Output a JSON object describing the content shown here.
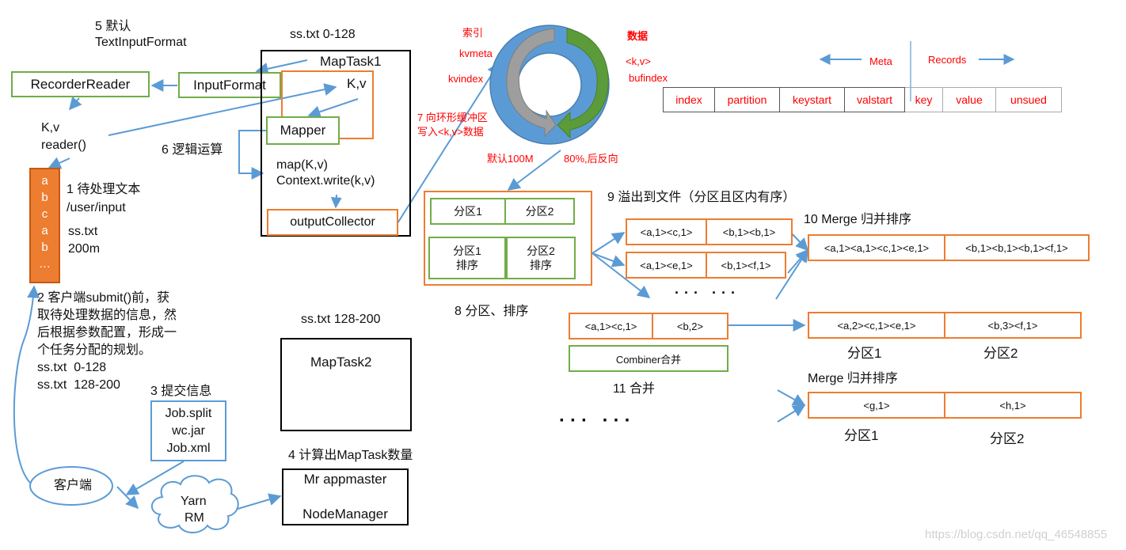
{
  "colors": {
    "green": "#70ad47",
    "orange": "#ed7d31",
    "blue": "#5b9bd5",
    "red": "#ff0000",
    "ring": "#5b9bd5",
    "gray_arrow": "#9e9e9e",
    "green_arrow": "#5c9b3a"
  },
  "step5": {
    "line1": "5 默认",
    "line2": "TextInputFormat"
  },
  "recorder_reader": "RecorderReader",
  "input_format": "InputFormat",
  "kv_reader": {
    "line1": "K,v",
    "line2": "reader()"
  },
  "step6": "6 逻辑运算",
  "maptask1": {
    "split_label": "ss.txt 0-128",
    "title": "MapTask1",
    "kv": "K,v",
    "mapper": "Mapper",
    "map_call": "map(K,v)",
    "context_write": "Context.write(k,v)",
    "output_collector": "outputCollector"
  },
  "input_file": {
    "letters": [
      "a",
      "b",
      "c",
      "a",
      "b",
      "…"
    ],
    "step1_line1": "1 待处理文本",
    "step1_line2": "/user/input",
    "file_name": "ss.txt",
    "file_size": "200m"
  },
  "step2": {
    "lines": [
      "2 客户端submit()前，获",
      "取待处理数据的信息，然",
      "后根据参数配置，形成一",
      "个任务分配的规划。"
    ],
    "split1": "ss.txt  0-128",
    "split2": "ss.txt  128-200"
  },
  "step3": {
    "label": "3 提交信息",
    "files": [
      "Job.split",
      "wc.jar",
      "Job.xml"
    ]
  },
  "client": "客户端",
  "yarn": {
    "line1": "Yarn",
    "line2": "RM"
  },
  "step4": {
    "label": "4 计算出MapTask数量",
    "line1": "Mr appmaster",
    "line2": "NodeManager"
  },
  "maptask2": {
    "split_label": "ss.txt 128-200",
    "title": "MapTask2"
  },
  "ring_buffer": {
    "index_label": "索引",
    "kvmeta": "kvmeta",
    "kvindex": "kvindex",
    "data_label": "数据",
    "kv": "<k,v>",
    "bufindex": "bufindex",
    "step7_line1": "7 向环形缓冲区",
    "step7_line2": "写入<k,v>数据",
    "default_size": "默认100M",
    "threshold": "80%,后反向"
  },
  "meta_records": {
    "meta": "Meta",
    "records": "Records",
    "meta_cells": [
      "index",
      "partition",
      "keystart",
      "valstart"
    ],
    "record_cells": [
      "key",
      "value",
      "unsued"
    ]
  },
  "step8": {
    "label": "8 分区、排序",
    "p1": "分区1",
    "p2": "分区2",
    "p1_sort": [
      "分区1",
      "排序"
    ],
    "p2_sort": [
      "分区2",
      "排序"
    ]
  },
  "step9": {
    "label": "9 溢出到文件（分区且区内有序）",
    "spill1": [
      "<a,1><c,1>",
      "<b,1><b,1>"
    ],
    "spill2": [
      "<a,1><e,1>",
      "<b,1><f,1>"
    ],
    "dots": "··· ···"
  },
  "step10": {
    "label": "10 Merge 归并排序",
    "merged": [
      "<a,1><a,1><c,1><e,1>",
      "<b,1><b,1><b,1><f,1>"
    ]
  },
  "step11": {
    "combined": [
      "<a,1><c,1>",
      "<b,2>"
    ],
    "combiner": "Combiner合并",
    "label": "11 合并",
    "dots": "··· ···"
  },
  "combined_output": {
    "cells": [
      "<a,2><c,1><e,1>",
      "<b,3><f,1>"
    ],
    "p1": "分区1",
    "p2": "分区2"
  },
  "merge2": {
    "label": "Merge 归并排序",
    "cells": [
      "<g,1>",
      "<h,1>"
    ],
    "p1": "分区1",
    "p2": "分区2"
  },
  "watermark": "https://blog.csdn.net/qq_46548855"
}
